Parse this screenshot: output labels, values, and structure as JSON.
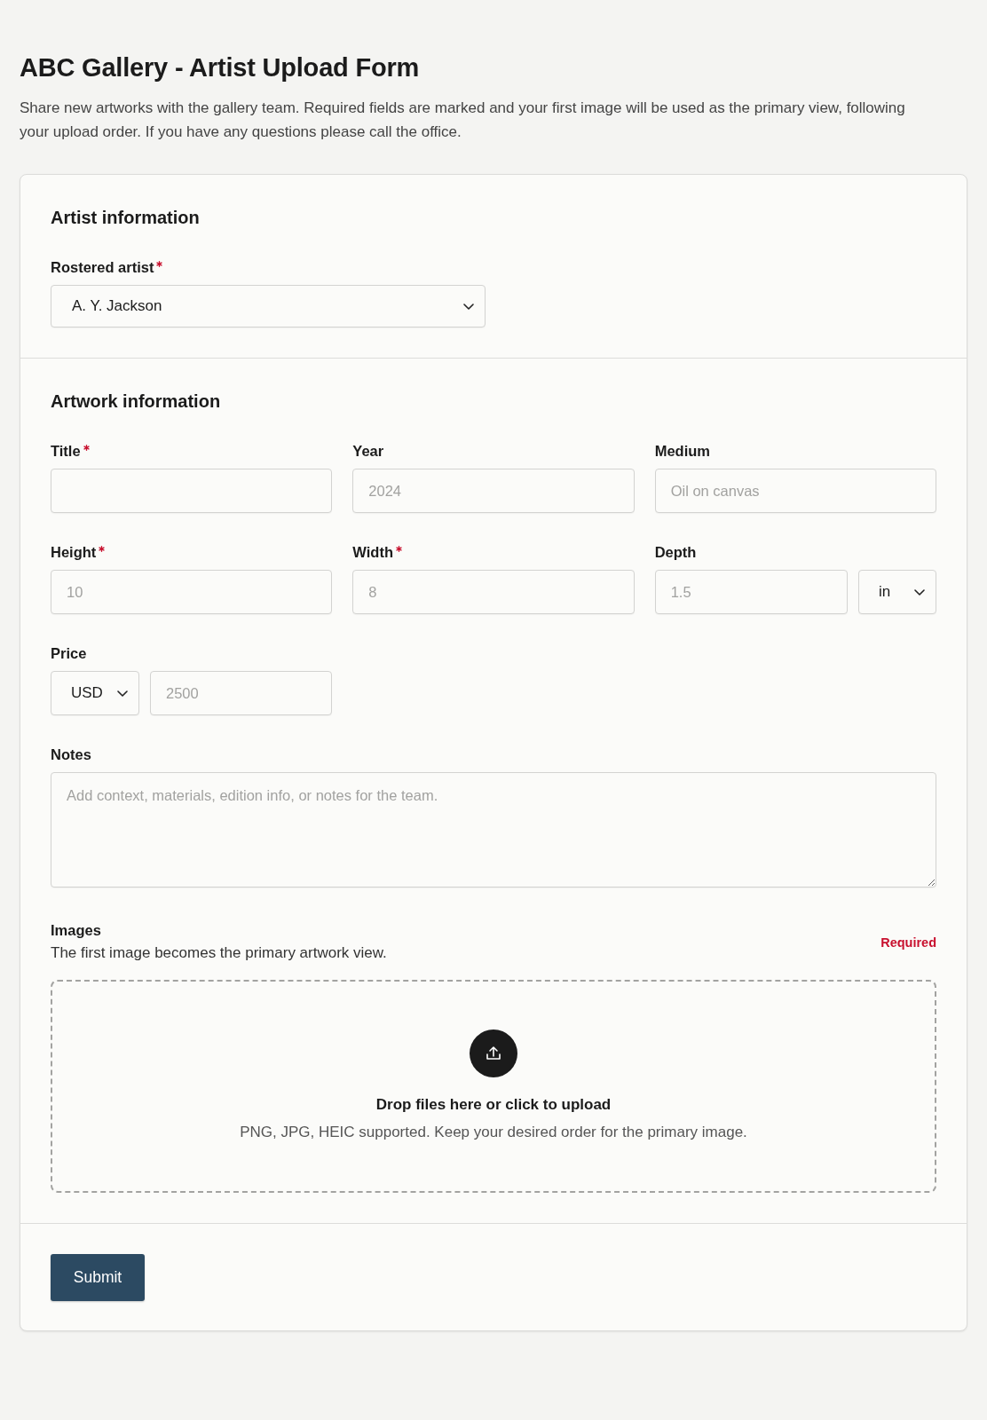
{
  "page": {
    "title": "ABC Gallery - Artist Upload Form",
    "intro": "Share new artworks with the gallery team. Required fields are marked and your first image will be used as the primary view, following your upload order. If you have any questions please call the office."
  },
  "sections": [
    {
      "heading": "Artist information",
      "rows": [
        {
          "fields": [
            {
              "kind": "select",
              "label": "Rostered artist",
              "required": true,
              "value": "A. Y. Jackson"
            }
          ]
        }
      ]
    },
    {
      "heading": "Artwork information",
      "rows": [
        {
          "fields": [
            {
              "kind": "input",
              "label": "Title",
              "required": true
            },
            {
              "kind": "input",
              "label": "Year",
              "required": false,
              "placeholder": "2024"
            },
            {
              "kind": "input",
              "label": "Medium",
              "required": false,
              "placeholder": "Oil on canvas"
            }
          ]
        },
        {
          "fields": [
            {
              "kind": "input",
              "label": "Height",
              "required": true,
              "placeholder": "10"
            },
            {
              "kind": "input",
              "label": "Width",
              "required": true,
              "placeholder": "8"
            },
            {
              "kind": "input_unit",
              "label": "Depth",
              "required": false,
              "placeholder": "1.5",
              "unit": "in"
            }
          ]
        },
        {
          "fields": [
            {
              "kind": "currency_input",
              "label": "Price",
              "required": false,
              "currency": "USD",
              "placeholder": "2500"
            }
          ]
        },
        {
          "fields": [
            {
              "kind": "textarea",
              "label": "Notes",
              "required": false,
              "placeholder": "Add context, materials, edition info, or notes for the team."
            }
          ]
        }
      ],
      "images": {
        "label": "Images",
        "hint": "The first image becomes the primary artwork view.",
        "badge": "Required",
        "dropzone": {
          "title": "Drop files here or click to upload",
          "hint": "PNG, JPG, HEIC supported. Keep your desired order for the primary image."
        }
      }
    }
  ],
  "submit": {
    "label": "Submit"
  }
}
